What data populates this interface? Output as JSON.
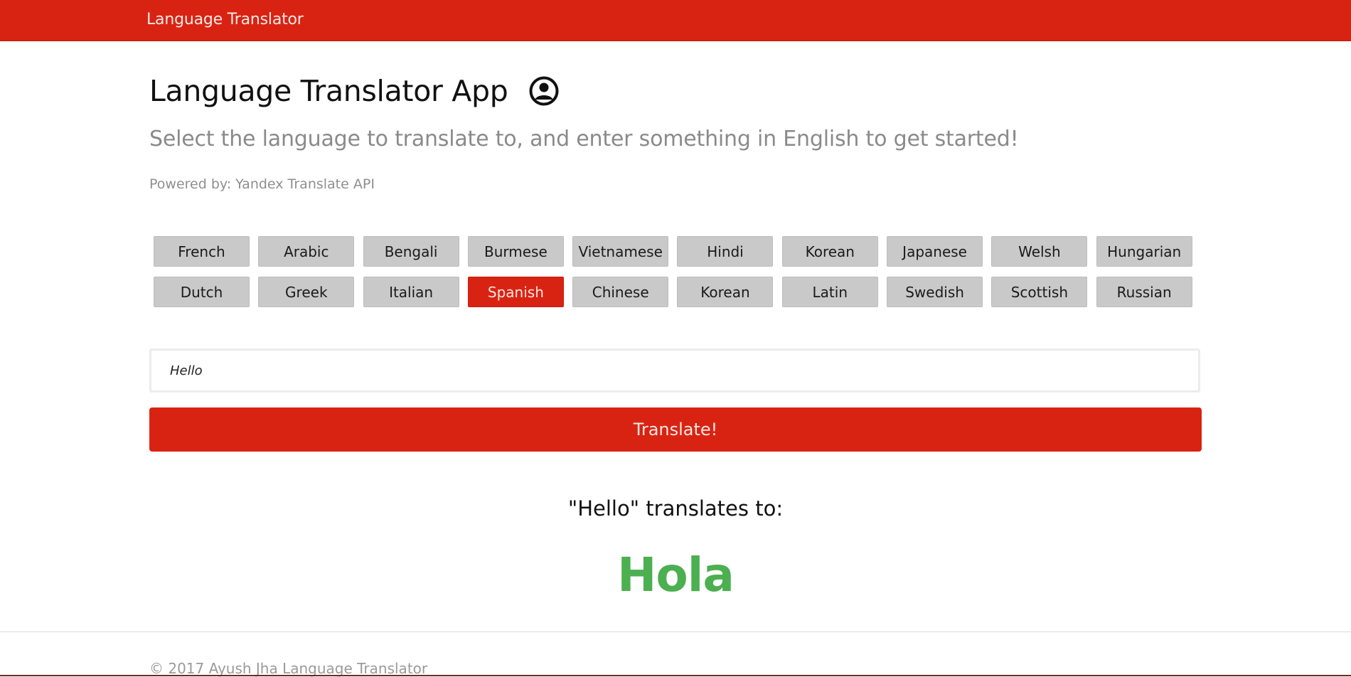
{
  "navbar": {
    "brand": "Language Translator"
  },
  "header": {
    "title": "Language Translator App",
    "user_icon": "user-circle-icon",
    "lead": "Select the language to translate to, and enter something in English to get started!",
    "powered_by": "Powered by: Yandex Translate API"
  },
  "languages": [
    {
      "label": "French"
    },
    {
      "label": "Arabic"
    },
    {
      "label": "Bengali"
    },
    {
      "label": "Burmese"
    },
    {
      "label": "Vietnamese"
    },
    {
      "label": "Hindi"
    },
    {
      "label": "Korean"
    },
    {
      "label": "Japanese"
    },
    {
      "label": "Welsh"
    },
    {
      "label": "Hungarian"
    },
    {
      "label": "Dutch"
    },
    {
      "label": "Greek"
    },
    {
      "label": "Italian"
    },
    {
      "label": "Spanish"
    },
    {
      "label": "Chinese"
    },
    {
      "label": "Korean"
    },
    {
      "label": "Latin"
    },
    {
      "label": "Swedish"
    },
    {
      "label": "Scottish"
    },
    {
      "label": "Russian"
    }
  ],
  "selected_language": "Spanish",
  "input": {
    "value": "Hello",
    "placeholder": ""
  },
  "translate_button": "Translate!",
  "result": {
    "label": "\"Hello\" translates to:",
    "value": "Hola"
  },
  "footer": {
    "text": "© 2017 Ayush Jha Language Translator"
  },
  "colors": {
    "accent": "#d92312",
    "result": "#4caf50",
    "button_bg": "#c9c9c9"
  }
}
